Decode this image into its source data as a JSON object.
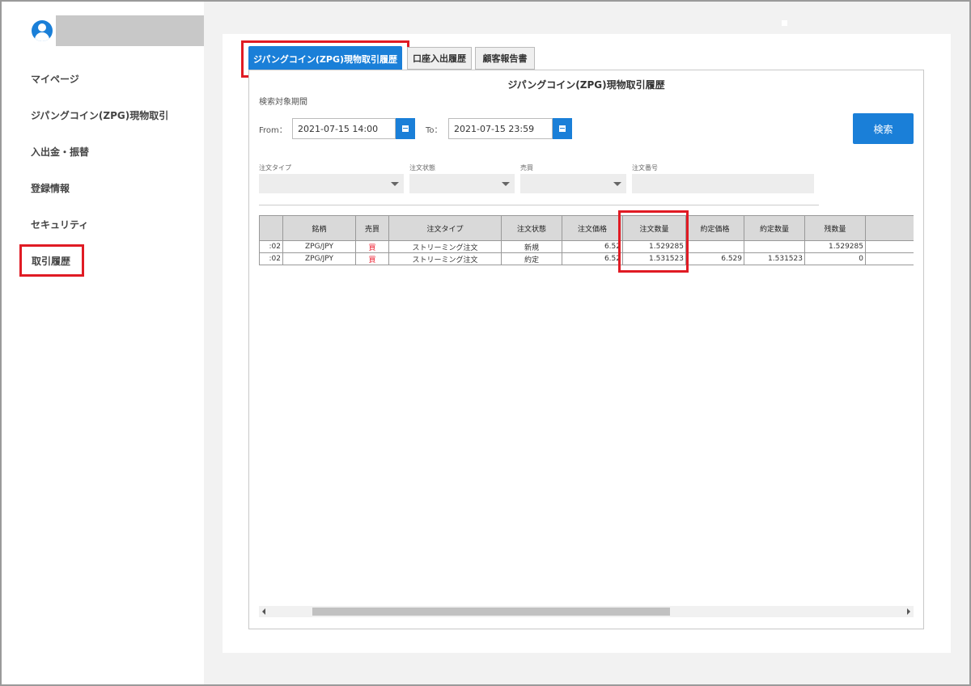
{
  "sidebar": {
    "items": [
      {
        "label": "マイページ"
      },
      {
        "label": "ジパングコイン(ZPG)現物取引"
      },
      {
        "label": "入出金・振替"
      },
      {
        "label": "登録情報"
      },
      {
        "label": "セキュリティ"
      },
      {
        "label": "取引履歴"
      }
    ],
    "active_index": 5
  },
  "tabs": [
    {
      "label": "ジパングコイン(ZPG)現物取引履歴"
    },
    {
      "label": "口座入出履歴"
    },
    {
      "label": "顧客報告書"
    }
  ],
  "panel": {
    "title": "ジパングコイン(ZPG)現物取引履歴",
    "period_label": "検索対象期間",
    "from_label": "From：",
    "from_value": "2021-07-15 14:00",
    "to_label": "To：",
    "to_value": "2021-07-15 23:59",
    "search_button": "検索",
    "filters": {
      "order_type": "注文タイプ",
      "order_status": "注文状態",
      "side": "売買",
      "order_number": "注文番号"
    }
  },
  "table": {
    "headers": [
      "",
      "銘柄",
      "売買",
      "注文タイプ",
      "注文状態",
      "注文価格",
      "注文数量",
      "約定価格",
      "約定数量",
      "残数量",
      ""
    ],
    "rows": [
      [
        ":02",
        "ZPG/JPY",
        "買",
        "ストリーミング注文",
        "新規",
        "6.52",
        "1.529285",
        "",
        "",
        "1.529285",
        ""
      ],
      [
        ":02",
        "ZPG/JPY",
        "買",
        "ストリーミング注文",
        "約定",
        "6.52",
        "1.531523",
        "6.529",
        "1.531523",
        "0",
        ""
      ]
    ]
  },
  "colors": {
    "accent": "#1a7fd8",
    "highlight": "#e01b24",
    "sell": "#e22233"
  },
  "icons": {
    "user": "user-icon",
    "calendar": "calendar-icon"
  }
}
